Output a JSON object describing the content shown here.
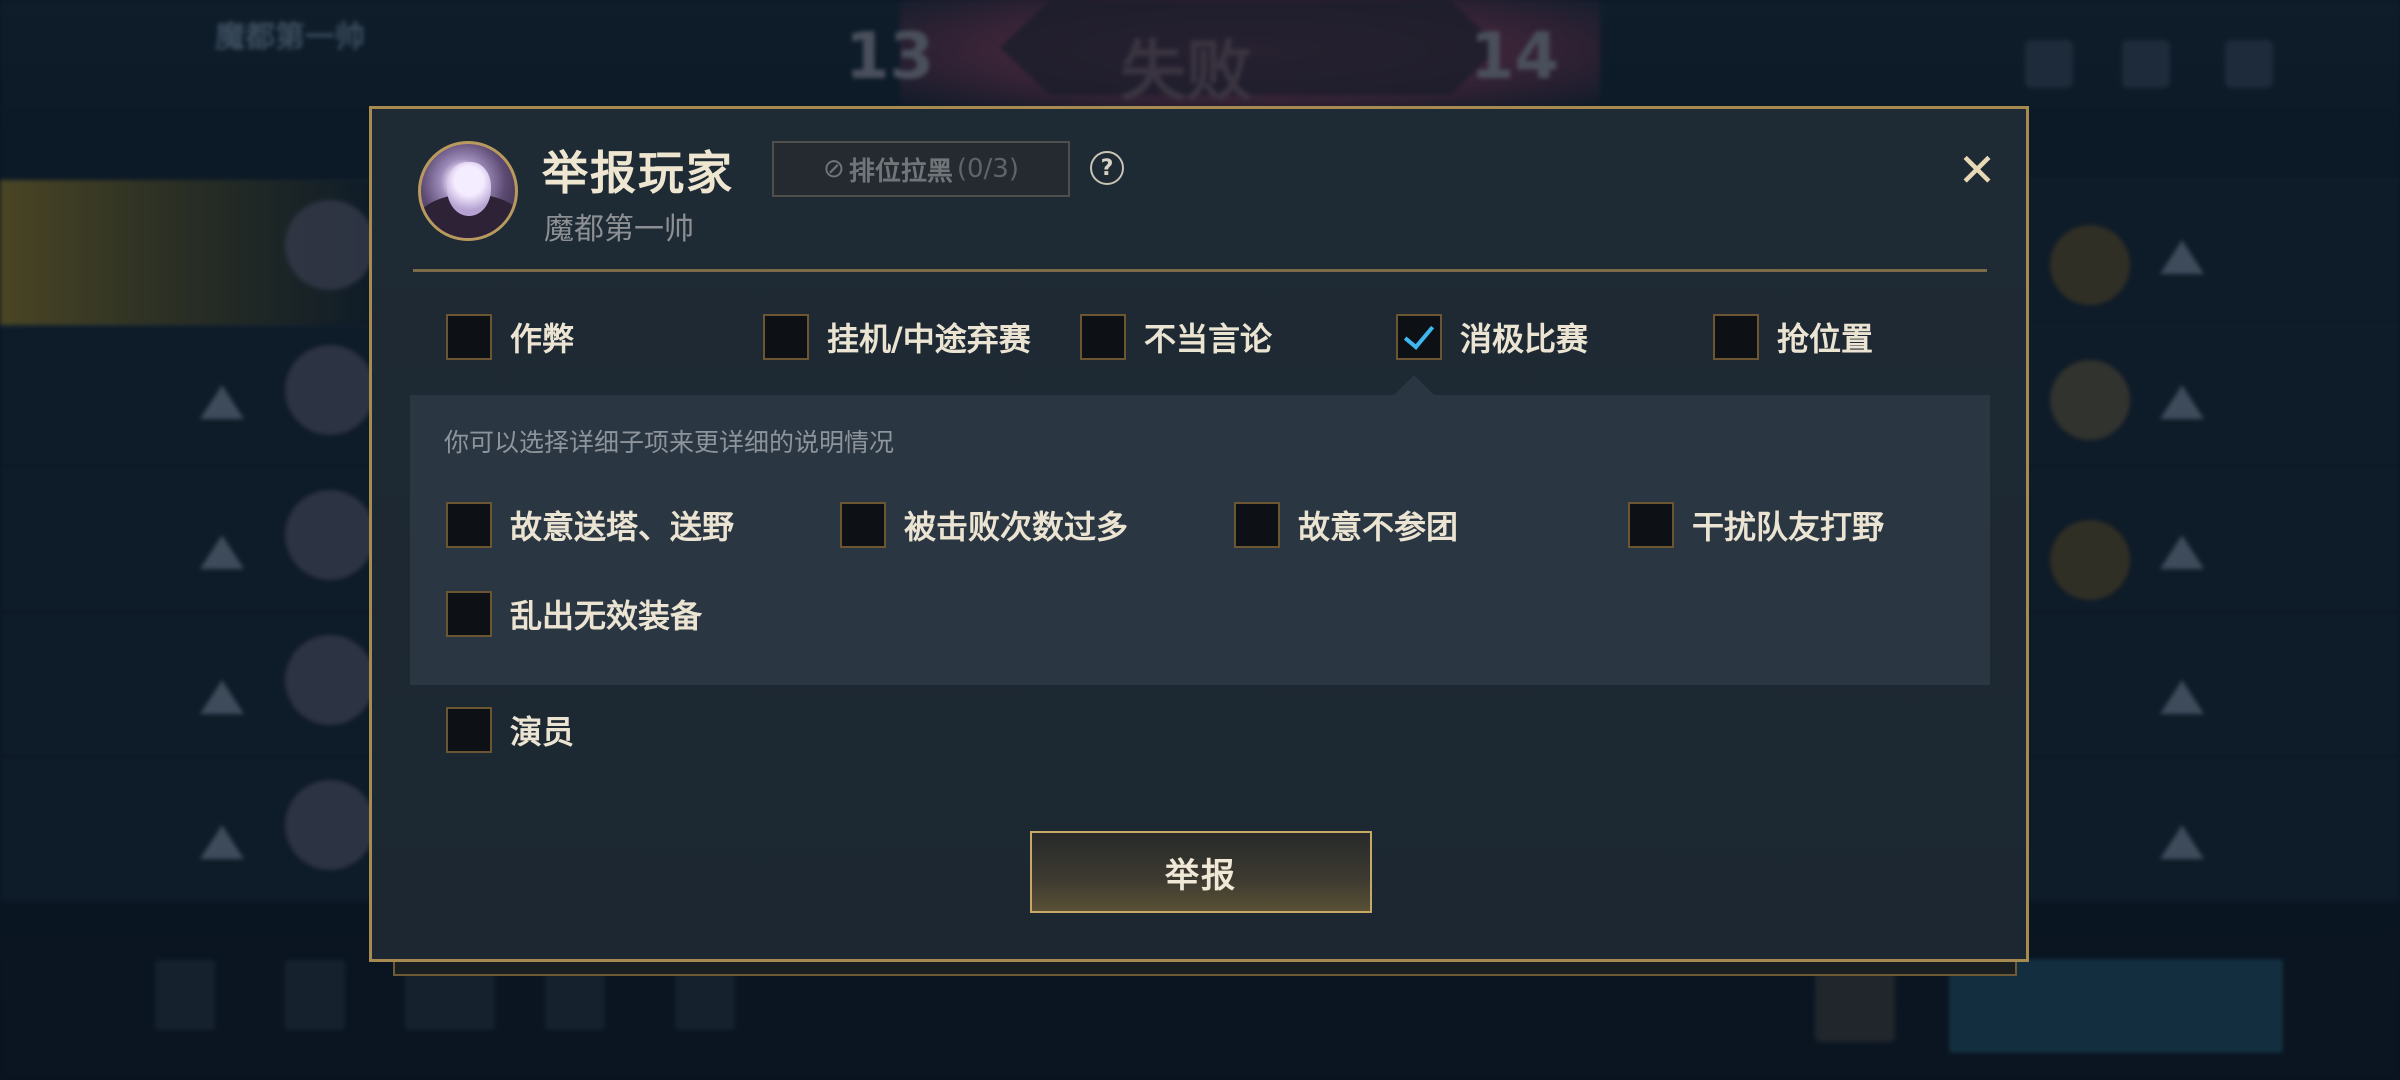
{
  "background": {
    "player_name": "魔都第一帅",
    "score_left": "13",
    "score_right": "14",
    "result": "失败"
  },
  "modal": {
    "title": "举报玩家",
    "player_name": "魔都第一帅",
    "blacklist_label": "排位拉黑",
    "blacklist_count": "(0/3)",
    "help": "?",
    "close": "✕",
    "categories": [
      {
        "label": "作弊",
        "checked": false
      },
      {
        "label": "挂机/中途弃赛",
        "checked": false
      },
      {
        "label": "不当言论",
        "checked": false
      },
      {
        "label": "消极比赛",
        "checked": true
      },
      {
        "label": "抢位置",
        "checked": false
      }
    ],
    "sub_hint": "你可以选择详细子项来更详细的说明情况",
    "sub_items": [
      {
        "label": "故意送塔、送野",
        "checked": false
      },
      {
        "label": "被击败次数过多",
        "checked": false
      },
      {
        "label": "故意不参团",
        "checked": false
      },
      {
        "label": "干扰队友打野",
        "checked": false
      },
      {
        "label": "乱出无效装备",
        "checked": false
      }
    ],
    "extra_items": [
      {
        "label": "演员",
        "checked": false
      }
    ],
    "submit_label": "举报"
  },
  "colors": {
    "accent_gold": "#a78a50",
    "check_blue": "#3fb7ef",
    "panel_bg": "#1d2832"
  },
  "icons": {
    "close": "close-icon",
    "help": "question-circle-icon",
    "ban": "ban-icon",
    "check": "check-icon"
  }
}
